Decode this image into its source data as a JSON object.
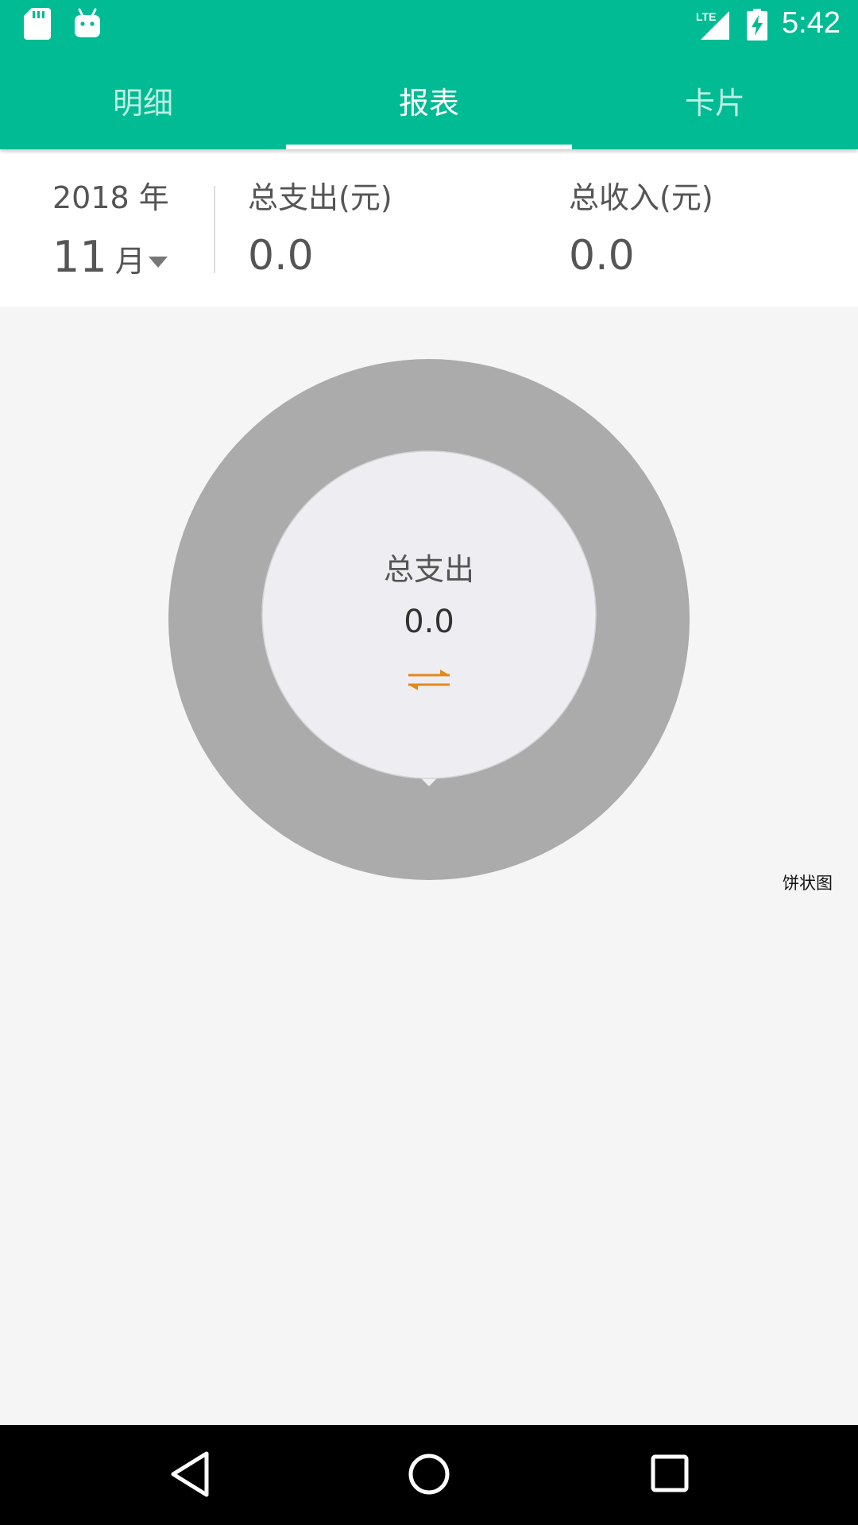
{
  "status_bar": {
    "time": "5:42",
    "network_label": "LTE",
    "icons": [
      "sd-card-icon",
      "android-icon",
      "signal-icon",
      "battery-charging-icon"
    ]
  },
  "tabs": [
    {
      "label": "明细",
      "active": false
    },
    {
      "label": "报表",
      "active": true
    },
    {
      "label": "卡片",
      "active": false
    }
  ],
  "summary": {
    "year": "2018 年",
    "month_number": "11",
    "month_unit": "月",
    "expense_label": "总支出(元)",
    "expense_value": "0.0",
    "income_label": "总收入(元)",
    "income_value": "0.0"
  },
  "chart": {
    "center_title": "总支出",
    "center_value": "0.0",
    "switch_icon": "swap-arrows-icon",
    "description": "饼状图",
    "ring_color": "#ababab",
    "center_color": "#eeeef2",
    "accent_color": "#e08a1a"
  },
  "chart_data": {
    "type": "pie",
    "title": "",
    "categories": [],
    "values": []
  },
  "navigation": {
    "buttons": [
      "back-icon",
      "home-icon",
      "recents-icon"
    ]
  },
  "colors": {
    "primary": "#00bb93",
    "background": "#f5f5f5"
  }
}
